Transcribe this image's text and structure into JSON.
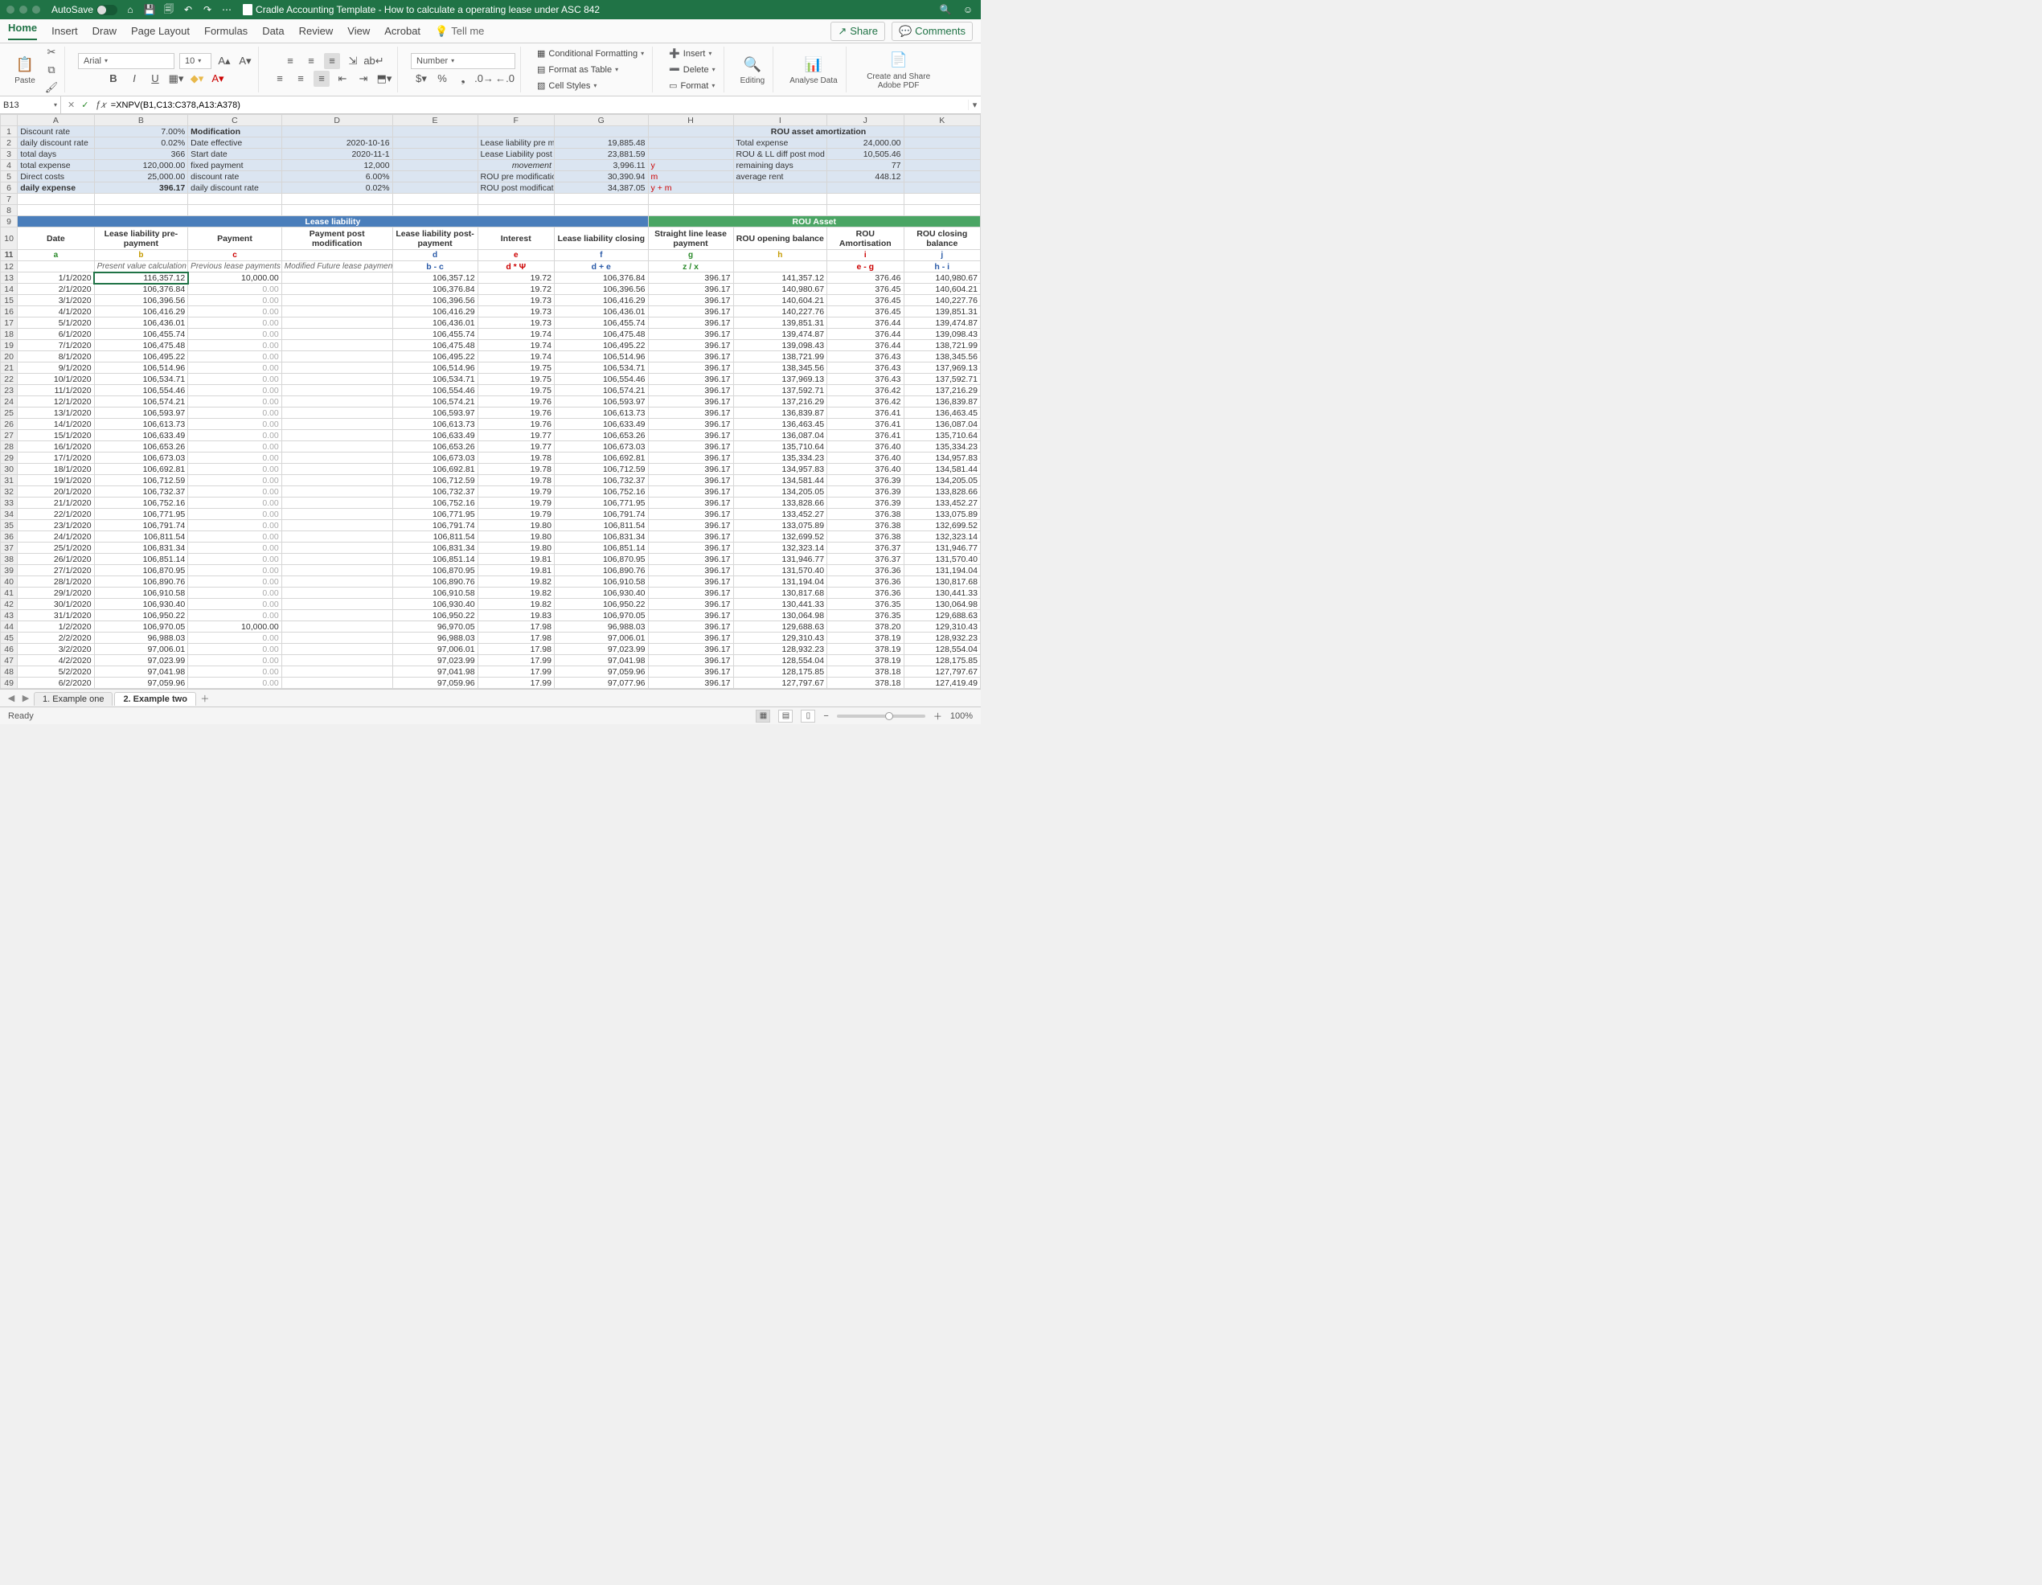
{
  "title": {
    "autosave": "AutoSave",
    "docname": "Cradle Accounting Template - How to calculate a operating lease under ASC 842"
  },
  "tabs": [
    "Home",
    "Insert",
    "Draw",
    "Page Layout",
    "Formulas",
    "Data",
    "Review",
    "View",
    "Acrobat",
    "Tell me"
  ],
  "tabbuttons": {
    "share": "Share",
    "comments": "Comments"
  },
  "ribbon": {
    "paste": "Paste",
    "font_name": "Arial",
    "font_size": "10",
    "number_format": "Number",
    "cond_format": "Conditional Formatting",
    "as_table": "Format as Table",
    "cell_styles": "Cell Styles",
    "insert": "Insert",
    "delete": "Delete",
    "format": "Format",
    "editing": "Editing",
    "analyse": "Analyse Data",
    "adobe": "Create and Share Adobe PDF"
  },
  "namebox": "B13",
  "formula": "=XNPV(B1,C13:C378,A13:A378)",
  "columns": [
    "A",
    "B",
    "C",
    "D",
    "E",
    "F",
    "G",
    "H",
    "I",
    "J",
    "K"
  ],
  "top": {
    "r1": {
      "A": "Discount rate",
      "B": "7.00%",
      "C": "Modification",
      "I": "ROU asset amortization"
    },
    "r2": {
      "A": "daily discount rate",
      "B": "0.02%",
      "C": "Date effective",
      "D": "2020-10-16",
      "F": "Lease liability pre modification",
      "G": "19,885.48",
      "I": "Total expense",
      "J": "24,000.00"
    },
    "r3": {
      "A": "total days",
      "B": "366",
      "C": "Start date",
      "D": "2020-11-1",
      "F": "Lease Liability post modification",
      "G": "23,881.59",
      "I": "ROU & LL diff post mod",
      "J": "10,505.46"
    },
    "r4": {
      "A": "total expense",
      "B": "120,000.00",
      "C": "fixed payment",
      "D": "12,000",
      "Fi": "movement",
      "G": "3,996.11",
      "Gy": "y",
      "I": "remaining days",
      "J": "77"
    },
    "r5": {
      "A": "Direct costs",
      "B": "25,000.00",
      "C": "discount rate",
      "D": "6.00%",
      "F": "ROU pre modification",
      "G": "30,390.94",
      "Gm": "m",
      "I": "average rent",
      "J": "448.12"
    },
    "r6": {
      "A": "daily expense",
      "B": "396.17",
      "C": "daily discount rate",
      "D": "0.02%",
      "F": "ROU post modification",
      "G": "34,387.05",
      "Gym": "y + m"
    }
  },
  "section": {
    "lease": "Lease liability",
    "rou": "ROU Asset"
  },
  "headers": {
    "A": "Date",
    "B": "Lease liability pre-payment",
    "C": "Payment",
    "D": "Payment post modification",
    "E": "Lease liability post-payment",
    "F": "Interest",
    "G": "Lease liability closing",
    "H": "Straight line lease payment",
    "I": "ROU opening balance",
    "J": "ROU Amortisation",
    "K": "ROU closing balance"
  },
  "letters": {
    "A": "a",
    "B": "b",
    "C": "c",
    "E": "d",
    "F": "e",
    "G": "f",
    "H": "g",
    "I": "h",
    "J": "i",
    "K": "j"
  },
  "subhead": {
    "B": "Present value calculation",
    "C": "Previous lease payments",
    "D": "Modified Future lease payments",
    "E": "b - c",
    "F": "d * Ψ",
    "G": "d + e",
    "H": "z / x",
    "J": "e - g",
    "K": "h - i"
  },
  "rows": [
    {
      "n": 13,
      "d": "1/1/2020",
      "b": "116,357.12",
      "c": "10,000.00",
      "e": "106,357.12",
      "f": "19.72",
      "g": "106,376.84",
      "h": "396.17",
      "i": "141,357.12",
      "j": "376.46",
      "k": "140,980.67"
    },
    {
      "n": 14,
      "d": "2/1/2020",
      "b": "106,376.84",
      "c": "0.00",
      "e": "106,376.84",
      "f": "19.72",
      "g": "106,396.56",
      "h": "396.17",
      "i": "140,980.67",
      "j": "376.45",
      "k": "140,604.21"
    },
    {
      "n": 15,
      "d": "3/1/2020",
      "b": "106,396.56",
      "c": "0.00",
      "e": "106,396.56",
      "f": "19.73",
      "g": "106,416.29",
      "h": "396.17",
      "i": "140,604.21",
      "j": "376.45",
      "k": "140,227.76"
    },
    {
      "n": 16,
      "d": "4/1/2020",
      "b": "106,416.29",
      "c": "0.00",
      "e": "106,416.29",
      "f": "19.73",
      "g": "106,436.01",
      "h": "396.17",
      "i": "140,227.76",
      "j": "376.45",
      "k": "139,851.31"
    },
    {
      "n": 17,
      "d": "5/1/2020",
      "b": "106,436.01",
      "c": "0.00",
      "e": "106,436.01",
      "f": "19.73",
      "g": "106,455.74",
      "h": "396.17",
      "i": "139,851.31",
      "j": "376.44",
      "k": "139,474.87"
    },
    {
      "n": 18,
      "d": "6/1/2020",
      "b": "106,455.74",
      "c": "0.00",
      "e": "106,455.74",
      "f": "19.74",
      "g": "106,475.48",
      "h": "396.17",
      "i": "139,474.87",
      "j": "376.44",
      "k": "139,098.43"
    },
    {
      "n": 19,
      "d": "7/1/2020",
      "b": "106,475.48",
      "c": "0.00",
      "e": "106,475.48",
      "f": "19.74",
      "g": "106,495.22",
      "h": "396.17",
      "i": "139,098.43",
      "j": "376.44",
      "k": "138,721.99"
    },
    {
      "n": 20,
      "d": "8/1/2020",
      "b": "106,495.22",
      "c": "0.00",
      "e": "106,495.22",
      "f": "19.74",
      "g": "106,514.96",
      "h": "396.17",
      "i": "138,721.99",
      "j": "376.43",
      "k": "138,345.56"
    },
    {
      "n": 21,
      "d": "9/1/2020",
      "b": "106,514.96",
      "c": "0.00",
      "e": "106,514.96",
      "f": "19.75",
      "g": "106,534.71",
      "h": "396.17",
      "i": "138,345.56",
      "j": "376.43",
      "k": "137,969.13"
    },
    {
      "n": 22,
      "d": "10/1/2020",
      "b": "106,534.71",
      "c": "0.00",
      "e": "106,534.71",
      "f": "19.75",
      "g": "106,554.46",
      "h": "396.17",
      "i": "137,969.13",
      "j": "376.43",
      "k": "137,592.71"
    },
    {
      "n": 23,
      "d": "11/1/2020",
      "b": "106,554.46",
      "c": "0.00",
      "e": "106,554.46",
      "f": "19.75",
      "g": "106,574.21",
      "h": "396.17",
      "i": "137,592.71",
      "j": "376.42",
      "k": "137,216.29"
    },
    {
      "n": 24,
      "d": "12/1/2020",
      "b": "106,574.21",
      "c": "0.00",
      "e": "106,574.21",
      "f": "19.76",
      "g": "106,593.97",
      "h": "396.17",
      "i": "137,216.29",
      "j": "376.42",
      "k": "136,839.87"
    },
    {
      "n": 25,
      "d": "13/1/2020",
      "b": "106,593.97",
      "c": "0.00",
      "e": "106,593.97",
      "f": "19.76",
      "g": "106,613.73",
      "h": "396.17",
      "i": "136,839.87",
      "j": "376.41",
      "k": "136,463.45"
    },
    {
      "n": 26,
      "d": "14/1/2020",
      "b": "106,613.73",
      "c": "0.00",
      "e": "106,613.73",
      "f": "19.76",
      "g": "106,633.49",
      "h": "396.17",
      "i": "136,463.45",
      "j": "376.41",
      "k": "136,087.04"
    },
    {
      "n": 27,
      "d": "15/1/2020",
      "b": "106,633.49",
      "c": "0.00",
      "e": "106,633.49",
      "f": "19.77",
      "g": "106,653.26",
      "h": "396.17",
      "i": "136,087.04",
      "j": "376.41",
      "k": "135,710.64"
    },
    {
      "n": 28,
      "d": "16/1/2020",
      "b": "106,653.26",
      "c": "0.00",
      "e": "106,653.26",
      "f": "19.77",
      "g": "106,673.03",
      "h": "396.17",
      "i": "135,710.64",
      "j": "376.40",
      "k": "135,334.23"
    },
    {
      "n": 29,
      "d": "17/1/2020",
      "b": "106,673.03",
      "c": "0.00",
      "e": "106,673.03",
      "f": "19.78",
      "g": "106,692.81",
      "h": "396.17",
      "i": "135,334.23",
      "j": "376.40",
      "k": "134,957.83"
    },
    {
      "n": 30,
      "d": "18/1/2020",
      "b": "106,692.81",
      "c": "0.00",
      "e": "106,692.81",
      "f": "19.78",
      "g": "106,712.59",
      "h": "396.17",
      "i": "134,957.83",
      "j": "376.40",
      "k": "134,581.44"
    },
    {
      "n": 31,
      "d": "19/1/2020",
      "b": "106,712.59",
      "c": "0.00",
      "e": "106,712.59",
      "f": "19.78",
      "g": "106,732.37",
      "h": "396.17",
      "i": "134,581.44",
      "j": "376.39",
      "k": "134,205.05"
    },
    {
      "n": 32,
      "d": "20/1/2020",
      "b": "106,732.37",
      "c": "0.00",
      "e": "106,732.37",
      "f": "19.79",
      "g": "106,752.16",
      "h": "396.17",
      "i": "134,205.05",
      "j": "376.39",
      "k": "133,828.66"
    },
    {
      "n": 33,
      "d": "21/1/2020",
      "b": "106,752.16",
      "c": "0.00",
      "e": "106,752.16",
      "f": "19.79",
      "g": "106,771.95",
      "h": "396.17",
      "i": "133,828.66",
      "j": "376.39",
      "k": "133,452.27"
    },
    {
      "n": 34,
      "d": "22/1/2020",
      "b": "106,771.95",
      "c": "0.00",
      "e": "106,771.95",
      "f": "19.79",
      "g": "106,791.74",
      "h": "396.17",
      "i": "133,452.27",
      "j": "376.38",
      "k": "133,075.89"
    },
    {
      "n": 35,
      "d": "23/1/2020",
      "b": "106,791.74",
      "c": "0.00",
      "e": "106,791.74",
      "f": "19.80",
      "g": "106,811.54",
      "h": "396.17",
      "i": "133,075.89",
      "j": "376.38",
      "k": "132,699.52"
    },
    {
      "n": 36,
      "d": "24/1/2020",
      "b": "106,811.54",
      "c": "0.00",
      "e": "106,811.54",
      "f": "19.80",
      "g": "106,831.34",
      "h": "396.17",
      "i": "132,699.52",
      "j": "376.38",
      "k": "132,323.14"
    },
    {
      "n": 37,
      "d": "25/1/2020",
      "b": "106,831.34",
      "c": "0.00",
      "e": "106,831.34",
      "f": "19.80",
      "g": "106,851.14",
      "h": "396.17",
      "i": "132,323.14",
      "j": "376.37",
      "k": "131,946.77"
    },
    {
      "n": 38,
      "d": "26/1/2020",
      "b": "106,851.14",
      "c": "0.00",
      "e": "106,851.14",
      "f": "19.81",
      "g": "106,870.95",
      "h": "396.17",
      "i": "131,946.77",
      "j": "376.37",
      "k": "131,570.40"
    },
    {
      "n": 39,
      "d": "27/1/2020",
      "b": "106,870.95",
      "c": "0.00",
      "e": "106,870.95",
      "f": "19.81",
      "g": "106,890.76",
      "h": "396.17",
      "i": "131,570.40",
      "j": "376.36",
      "k": "131,194.04"
    },
    {
      "n": 40,
      "d": "28/1/2020",
      "b": "106,890.76",
      "c": "0.00",
      "e": "106,890.76",
      "f": "19.82",
      "g": "106,910.58",
      "h": "396.17",
      "i": "131,194.04",
      "j": "376.36",
      "k": "130,817.68"
    },
    {
      "n": 41,
      "d": "29/1/2020",
      "b": "106,910.58",
      "c": "0.00",
      "e": "106,910.58",
      "f": "19.82",
      "g": "106,930.40",
      "h": "396.17",
      "i": "130,817.68",
      "j": "376.36",
      "k": "130,441.33"
    },
    {
      "n": 42,
      "d": "30/1/2020",
      "b": "106,930.40",
      "c": "0.00",
      "e": "106,930.40",
      "f": "19.82",
      "g": "106,950.22",
      "h": "396.17",
      "i": "130,441.33",
      "j": "376.35",
      "k": "130,064.98"
    },
    {
      "n": 43,
      "d": "31/1/2020",
      "b": "106,950.22",
      "c": "0.00",
      "e": "106,950.22",
      "f": "19.83",
      "g": "106,970.05",
      "h": "396.17",
      "i": "130,064.98",
      "j": "376.35",
      "k": "129,688.63"
    },
    {
      "n": 44,
      "d": "1/2/2020",
      "b": "106,970.05",
      "c": "10,000.00",
      "e": "96,970.05",
      "f": "17.98",
      "g": "96,988.03",
      "h": "396.17",
      "i": "129,688.63",
      "j": "378.20",
      "k": "129,310.43"
    },
    {
      "n": 45,
      "d": "2/2/2020",
      "b": "96,988.03",
      "c": "0.00",
      "e": "96,988.03",
      "f": "17.98",
      "g": "97,006.01",
      "h": "396.17",
      "i": "129,310.43",
      "j": "378.19",
      "k": "128,932.23"
    },
    {
      "n": 46,
      "d": "3/2/2020",
      "b": "97,006.01",
      "c": "0.00",
      "e": "97,006.01",
      "f": "17.98",
      "g": "97,023.99",
      "h": "396.17",
      "i": "128,932.23",
      "j": "378.19",
      "k": "128,554.04"
    },
    {
      "n": 47,
      "d": "4/2/2020",
      "b": "97,023.99",
      "c": "0.00",
      "e": "97,023.99",
      "f": "17.99",
      "g": "97,041.98",
      "h": "396.17",
      "i": "128,554.04",
      "j": "378.19",
      "k": "128,175.85"
    },
    {
      "n": 48,
      "d": "5/2/2020",
      "b": "97,041.98",
      "c": "0.00",
      "e": "97,041.98",
      "f": "17.99",
      "g": "97,059.96",
      "h": "396.17",
      "i": "128,175.85",
      "j": "378.18",
      "k": "127,797.67"
    },
    {
      "n": 49,
      "d": "6/2/2020",
      "b": "97,059.96",
      "c": "0.00",
      "e": "97,059.96",
      "f": "17.99",
      "g": "97,077.96",
      "h": "396.17",
      "i": "127,797.67",
      "j": "378.18",
      "k": "127,419.49"
    }
  ],
  "sheets": [
    "1. Example one",
    "2. Example two"
  ],
  "status": "Ready",
  "zoom": "100%"
}
